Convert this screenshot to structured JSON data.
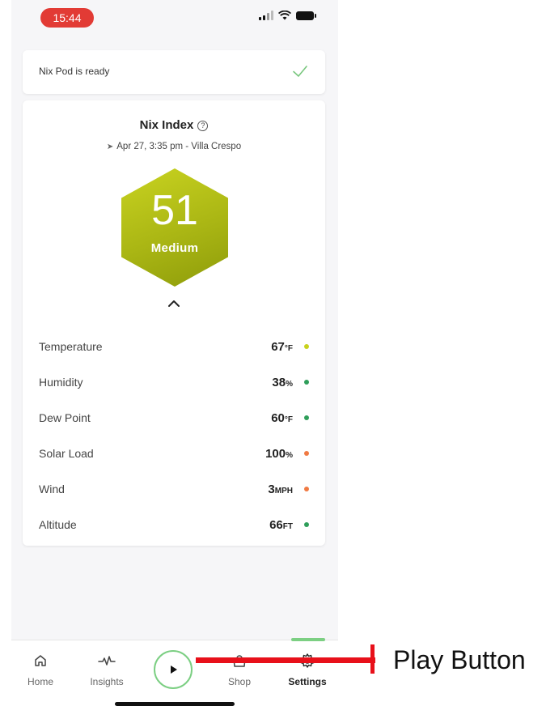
{
  "status_bar": {
    "time": "15:44"
  },
  "notice": {
    "text": "Nix Pod is ready"
  },
  "index": {
    "title": "Nix Index",
    "location": "Apr 27, 3:35 pm - Villa Crespo",
    "value": "51",
    "level": "Medium",
    "level_color": "#aab614"
  },
  "metrics": [
    {
      "label": "Temperature",
      "value": "67",
      "unit": "°F",
      "dot_color": "#c8d21d"
    },
    {
      "label": "Humidity",
      "value": "38",
      "unit": "%",
      "dot_color": "#2f9e5a"
    },
    {
      "label": "Dew Point",
      "value": "60",
      "unit": "°F",
      "dot_color": "#2f9e5a"
    },
    {
      "label": "Solar Load",
      "value": "100",
      "unit": "%",
      "dot_color": "#f07a43"
    },
    {
      "label": "Wind",
      "value": "3",
      "unit": "MPH",
      "dot_color": "#f07a43"
    },
    {
      "label": "Altitude",
      "value": "66",
      "unit": "FT",
      "dot_color": "#2f9e5a"
    }
  ],
  "nav": {
    "home": "Home",
    "insights": "Insights",
    "shop": "Shop",
    "settings": "Settings"
  },
  "annotation": {
    "label": "Play Button",
    "color": "#e8101a"
  }
}
